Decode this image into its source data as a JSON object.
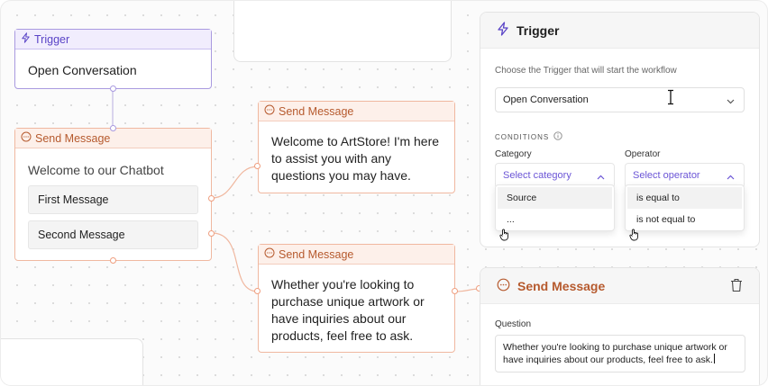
{
  "canvas": {
    "trigger_node": {
      "title": "Trigger",
      "value": "Open Conversation"
    },
    "chatbot_node": {
      "title": "Send Message",
      "text": "Welcome to our Chatbot",
      "buttons": [
        "First Message",
        "Second Message"
      ]
    },
    "message_node_1": {
      "title": "Send Message",
      "lines": [
        "Welcome to ArtStore! I'm here",
        "to assist you with any",
        "questions you may have."
      ]
    },
    "message_node_2": {
      "title": "Send Message",
      "lines": [
        "Whether you're looking to",
        "purchase unique artwork or",
        "have inquiries about our",
        "products, feel free to ask."
      ]
    }
  },
  "trigger_panel": {
    "title": "Trigger",
    "description": "Choose the Trigger that will start the workflow",
    "trigger_select": "Open Conversation",
    "conditions_label": "CONDITIONS",
    "category": {
      "label": "Category",
      "placeholder": "Select category",
      "options": [
        "Source",
        "..."
      ]
    },
    "operator": {
      "label": "Operator",
      "placeholder": "Select operator",
      "options": [
        "is equal to",
        "is not equal to"
      ]
    }
  },
  "message_panel": {
    "title": "Send Message",
    "question_label": "Question",
    "question_lines": [
      "Whether you're looking to purchase unique artwork or",
      "have inquiries about our products, feel free to ask."
    ]
  },
  "colors": {
    "trigger_accent": "#5a44c7",
    "message_accent": "#b65a2e",
    "select_placeholder": "#6b55d6"
  }
}
